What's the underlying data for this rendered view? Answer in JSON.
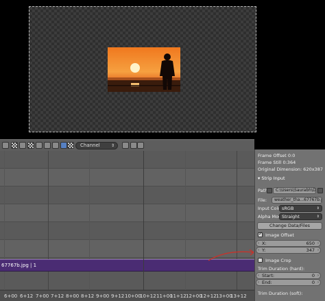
{
  "header": {
    "channel_label": "Channel",
    "channel_arrows": "⇕"
  },
  "timeline": {
    "strip_label": "67767b.jpg | 1",
    "ruler_ticks": [
      "6+00",
      "6+12",
      "7+00",
      "7+12",
      "8+00",
      "8+12",
      "9+00",
      "9+12",
      "10+00",
      "10+12",
      "11+00",
      "11+12",
      "12+00",
      "12+12",
      "13+00",
      "13+12"
    ]
  },
  "panel": {
    "frame_offset": "Frame Offset 0:0",
    "frame_still": "Frame Still 0:364",
    "original_dimension": "Original Dimension: 620x387",
    "strip_input_label": "Strip Input",
    "path_label": "Path:",
    "path_value": "C:\\Users\\Saurabh\\De...",
    "file_label": "File:",
    "file_value": "weather_tha...67767b.jpg",
    "input_color_label": "Input Colo",
    "input_color_value": "sRGB",
    "alpha_mode_label": "Alpha Mod",
    "alpha_mode_value": "Straight",
    "change_data_button": "Change Data/Files",
    "image_offset_label": "Image Offset",
    "image_offset_checked": true,
    "x_label": "X:",
    "x_value": "650",
    "y_label": "Y:",
    "y_value": "347",
    "image_crop_label": "Image Crop",
    "image_crop_checked": false,
    "trim_hard_label": "Trim Duration (hard):",
    "start_label": "Start:",
    "start_value": "0",
    "end_label": "End:",
    "end_value": "0",
    "trim_soft_label": "Trim Duration (soft):"
  },
  "colors": {
    "strip": "#4a2c73",
    "annotation_arrow": "#c8322a"
  }
}
